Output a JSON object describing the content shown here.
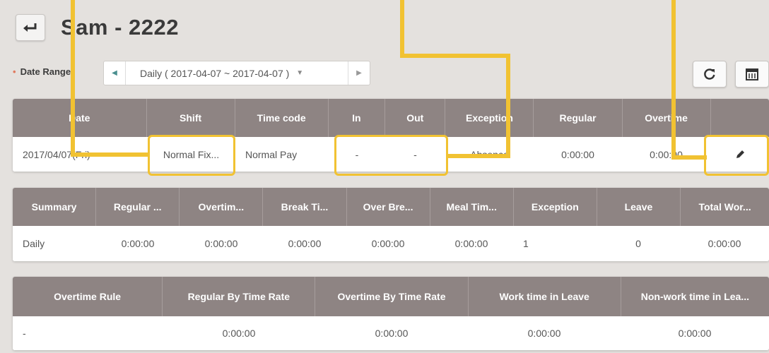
{
  "header": {
    "back_icon": "return-arrow-icon",
    "title": "Sam - 2222"
  },
  "date_range": {
    "label": "Date Range",
    "value": "Daily ( 2017-04-07 ~ 2017-04-07 )",
    "prev_icon": "triangle-left-icon",
    "next_icon": "triangle-right-icon",
    "dropdown_icon": "triangle-down-icon"
  },
  "toolbar": {
    "refresh_icon": "refresh-icon",
    "calendar_icon": "calendar-icon"
  },
  "timecard": {
    "headers": [
      "Date",
      "Shift",
      "Time code",
      "In",
      "Out",
      "Exception",
      "Regular",
      "Overtime",
      ""
    ],
    "row": [
      "2017/04/07(Fri)",
      "Normal Fix...",
      "Normal Pay",
      "-",
      "-",
      "Absence",
      "0:00:00",
      "0:00:00",
      ""
    ],
    "edit_icon": "pencil-icon"
  },
  "summary": {
    "headers": [
      "Summary",
      "Regular ...",
      "Overtim...",
      "Break Ti...",
      "Over Bre...",
      "Meal Tim...",
      "Exception",
      "Leave",
      "Total Wor..."
    ],
    "row": [
      "Daily",
      "0:00:00",
      "0:00:00",
      "0:00:00",
      "0:00:00",
      "0:00:00",
      "1",
      "0",
      "0:00:00"
    ]
  },
  "overtime": {
    "headers": [
      "Overtime Rule",
      "Regular By Time Rate",
      "Overtime By Time Rate",
      "Work time in Leave",
      "Non-work time in Lea..."
    ],
    "row": [
      "-",
      "0:00:00",
      "0:00:00",
      "0:00:00",
      "0:00:00"
    ]
  },
  "colors": {
    "header_bg": "#8e8483",
    "page_bg": "#e4e1de",
    "highlight": "#f1c232",
    "accent": "#4a8f8f"
  }
}
